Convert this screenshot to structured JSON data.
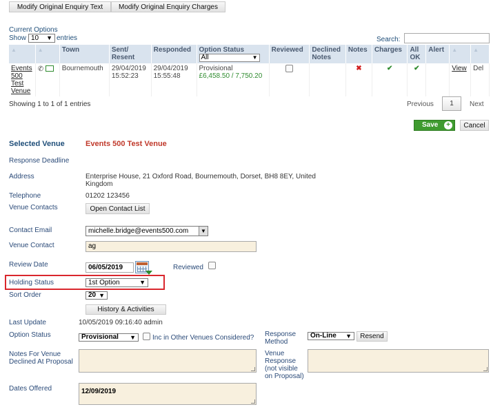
{
  "toolbar": {
    "modify_text": "Modify Original Enquiry Text",
    "modify_charges": "Modify Original Enquiry Charges"
  },
  "options": {
    "title": "Current Options",
    "show_label": "Show",
    "show_value": "10",
    "entries_label": "entries",
    "search_label": "Search:",
    "search_value": "",
    "columns": [
      "Town",
      "Sent/ Resent",
      "Responded",
      "Option Status",
      "Reviewed",
      "Declined Notes",
      "Notes",
      "Charges",
      "All OK",
      "Alert"
    ],
    "status_filter": "All",
    "row": {
      "venue": "Events 500 Test Venue",
      "town": "Bournemouth",
      "sent": "29/04/2019 15:52:23",
      "responded": "29/04/2019 15:55:48",
      "status": "Provisional",
      "price": "£6,458.50 / 7,750.20",
      "view": "View",
      "del": "Del"
    },
    "showing": "Showing 1 to 1 of 1 entries",
    "previous": "Previous",
    "page": "1",
    "next": "Next"
  },
  "actions": {
    "save": "Save",
    "cancel": "Cancel"
  },
  "colors": {
    "accent_red": "#c0392b",
    "save_green": "#3f9b2f",
    "highlight_box": "#d9262c"
  },
  "venue": {
    "selected_label": "Selected Venue",
    "selected_value": "Events 500 Test Venue",
    "deadline_label": "Response Deadline",
    "address_label": "Address",
    "address_value": "Enterprise House, 21 Oxford Road, Bournemouth, Dorset, BH8 8EY, United Kingdom",
    "telephone_label": "Telephone",
    "telephone_value": "01202 123456",
    "contacts_label": "Venue Contacts",
    "open_contacts": "Open Contact List",
    "email_label": "Contact Email",
    "email_value": "michelle.bridge@events500.com",
    "contact_label": "Venue Contact",
    "contact_value": "ag",
    "review_label": "Review Date",
    "review_value": "06/05/2019",
    "reviewed_label": "Reviewed",
    "holding_label": "Holding Status",
    "holding_value": "1st Option",
    "sort_label": "Sort Order",
    "sort_value": "20",
    "history_button": "History & Activities",
    "last_update_label": "Last Update",
    "last_update_value": "10/05/2019 09:16:40 admin",
    "option_status_label": "Option Status",
    "option_status_value": "Provisional",
    "inc_other_label": "Inc in Other Venues Considered?",
    "response_method_label": "Response Method",
    "response_method_value": "On-Line",
    "resend": "Resend",
    "notes_declined_label": "Notes For Venue Declined At Proposal",
    "venue_response_label": "Venue Response (not visible on Proposal)",
    "dates_offered_label": "Dates Offered",
    "dates_offered_value": "12/09/2019"
  }
}
